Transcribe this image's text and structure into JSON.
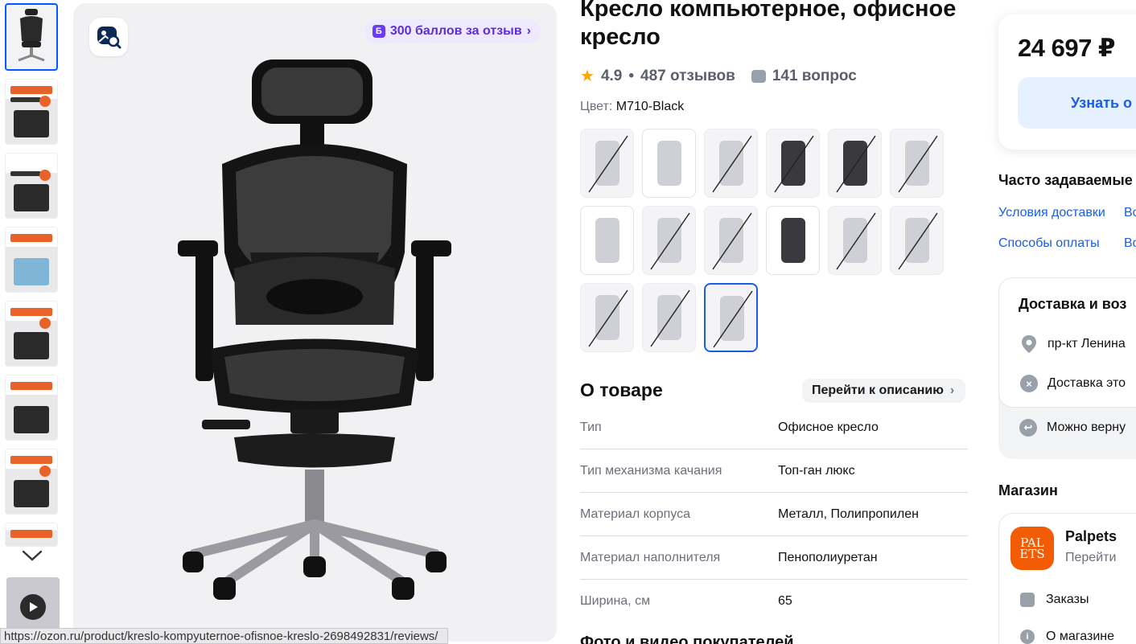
{
  "main": {
    "bonus_label": "300 баллов за отзыв",
    "bonus_badge": "Б"
  },
  "product": {
    "title": "Кресло компьютерное, офисное кресло",
    "rating": "4.9",
    "reviews": "487 отзывов",
    "separator": "•",
    "questions": "141 вопрос",
    "color_label": "Цвет:",
    "color_value": "M710-Black"
  },
  "about": {
    "title": "О товаре",
    "goto_label": "Перейти к описанию",
    "specs": [
      {
        "key": "Тип",
        "value": "Офисное кресло"
      },
      {
        "key": "Тип механизма качания",
        "value": "Топ-ган люкс"
      },
      {
        "key": "Материал корпуса",
        "value": "Металл, Полипропилен"
      },
      {
        "key": "Материал наполнителя",
        "value": "Пенополиуретан"
      },
      {
        "key": "Ширина, см",
        "value": "65"
      }
    ],
    "photos_title": "Фото и видео покупателей"
  },
  "buy": {
    "price": "24 697 ₽",
    "find_button": "Узнать о"
  },
  "faq": {
    "title": "Часто задаваемые",
    "links": [
      "Условия доставки",
      "Во",
      "Способы оплаты",
      "Во"
    ]
  },
  "delivery": {
    "title": "Доставка и воз",
    "address": "пр-кт Ленина",
    "delivery_note": "Доставка это",
    "return_note": "Можно верну"
  },
  "shop": {
    "title": "Магазин",
    "logo_text": "PAL ETS",
    "name": "Palpets",
    "go": "Перейти",
    "orders": "Заказы",
    "about": "О магазине"
  },
  "statusbar": {
    "url": "https://ozon.ru/product/kreslo-kompyuternoe-ofisnoe-kreslo-2698492831/reviews/"
  },
  "icons": {
    "zoom": "image-search-icon",
    "star": "star-icon",
    "question": "chat-question-icon",
    "chevron_down": "chevron-down-icon",
    "play": "play-icon",
    "pin": "location-pin-icon",
    "cross": "close-circle-icon",
    "return": "return-icon"
  },
  "colors": {
    "accent": "#005bff",
    "star": "#ffa500",
    "bonus": "#6a3df0",
    "shop_logo": "#f25c05"
  }
}
